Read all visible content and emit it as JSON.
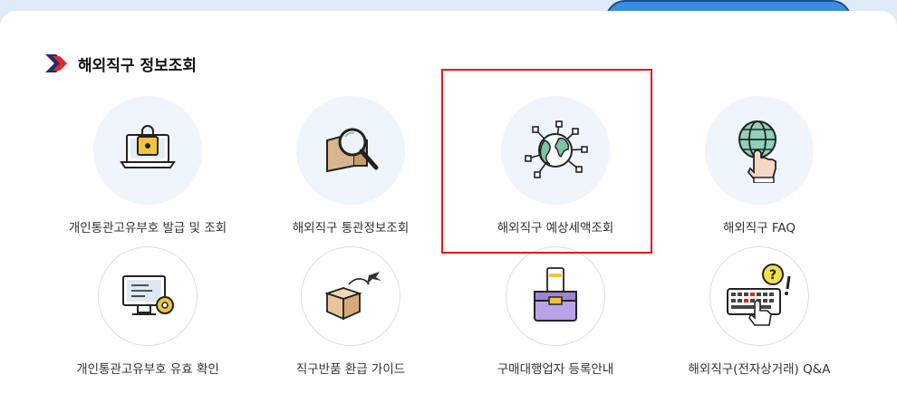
{
  "section": {
    "title": "해외직구 정보조회"
  },
  "items_row1": [
    {
      "label": "개인통관고유부호 발급 및 조회",
      "icon": "laptop-lock-icon"
    },
    {
      "label": "해외직구 통관정보조회",
      "icon": "box-magnifier-icon"
    },
    {
      "label": "해외직구 예상세액조회",
      "icon": "globe-network-icon"
    },
    {
      "label": "해외직구 FAQ",
      "icon": "globe-hand-icon"
    }
  ],
  "items_row2": [
    {
      "label": "개인통관고유부호 유효 확인",
      "icon": "monitor-gear-icon"
    },
    {
      "label": "직구반품 환급 가이드",
      "icon": "box-airplane-icon"
    },
    {
      "label": "구매대행업자 등록안내",
      "icon": "shopping-bag-icon"
    },
    {
      "label": "해외직구(전자상거래) Q&A",
      "icon": "keyboard-question-icon"
    }
  ],
  "colors": {
    "highlight": "#e21a1a",
    "circle_fill": "#eef5fd",
    "accent_blue": "#1c4f8a",
    "accent_red": "#e8242b"
  }
}
